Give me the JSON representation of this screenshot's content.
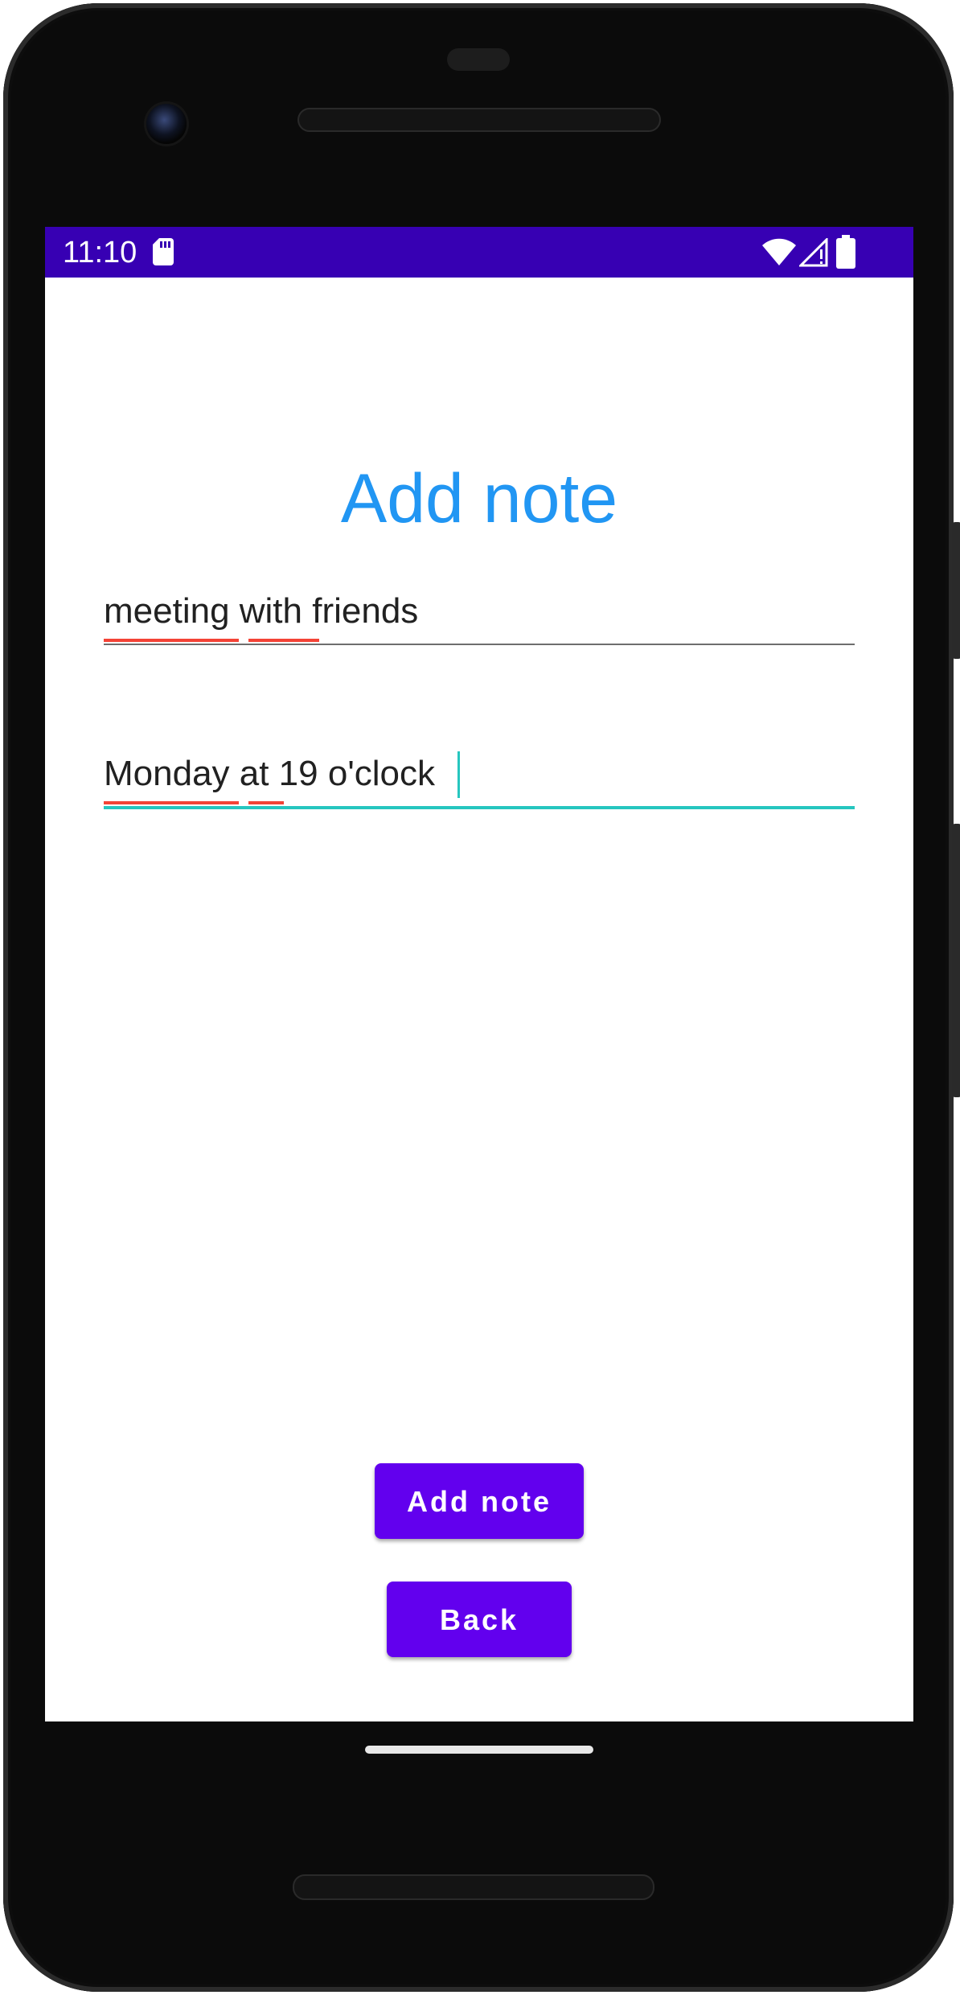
{
  "status_bar": {
    "time": "11:10",
    "background_color": "#3700b3",
    "icons": [
      "sd-card-icon",
      "wifi-icon",
      "signal-icon",
      "battery-icon"
    ]
  },
  "screen": {
    "title": "Add note",
    "title_color": "#2196f3",
    "fields": [
      {
        "value": "meeting with friends",
        "focused": false,
        "misspelled": [
          "meeting",
          "with"
        ]
      },
      {
        "value": "Monday at 19 o'clock",
        "focused": true,
        "misspelled": [
          "Monday",
          "at"
        ]
      }
    ],
    "focus_color": "#26c6bf",
    "buttons": {
      "add_label": "Add note",
      "back_label": "Back",
      "color": "#6200ee"
    }
  }
}
